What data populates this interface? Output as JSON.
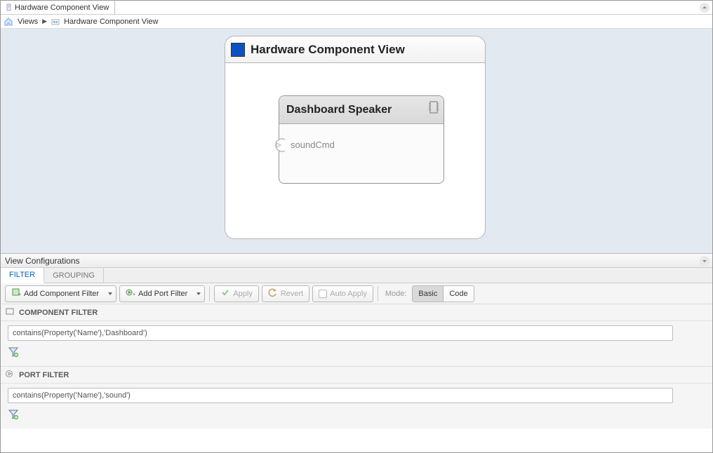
{
  "tab": {
    "title": "Hardware Component View"
  },
  "breadcrumb": {
    "root": "Views",
    "current": "Hardware Component View"
  },
  "diagram": {
    "title": "Hardware Component View",
    "component": {
      "name": "Dashboard Speaker",
      "port": "soundCmd"
    }
  },
  "config_panel": {
    "title": "View Configurations",
    "tabs": [
      "FILTER",
      "GROUPING"
    ],
    "toolbar": {
      "add_component_filter": "Add Component Filter",
      "add_port_filter": "Add Port Filter",
      "apply": "Apply",
      "revert": "Revert",
      "auto_apply": "Auto Apply",
      "mode_label": "Mode:",
      "mode_basic": "Basic",
      "mode_code": "Code"
    },
    "component_filter": {
      "heading": "COMPONENT FILTER",
      "expression": "contains(Property('Name'),'Dashboard')"
    },
    "port_filter": {
      "heading": "PORT FILTER",
      "expression": "contains(Property('Name'),'sound')"
    }
  }
}
